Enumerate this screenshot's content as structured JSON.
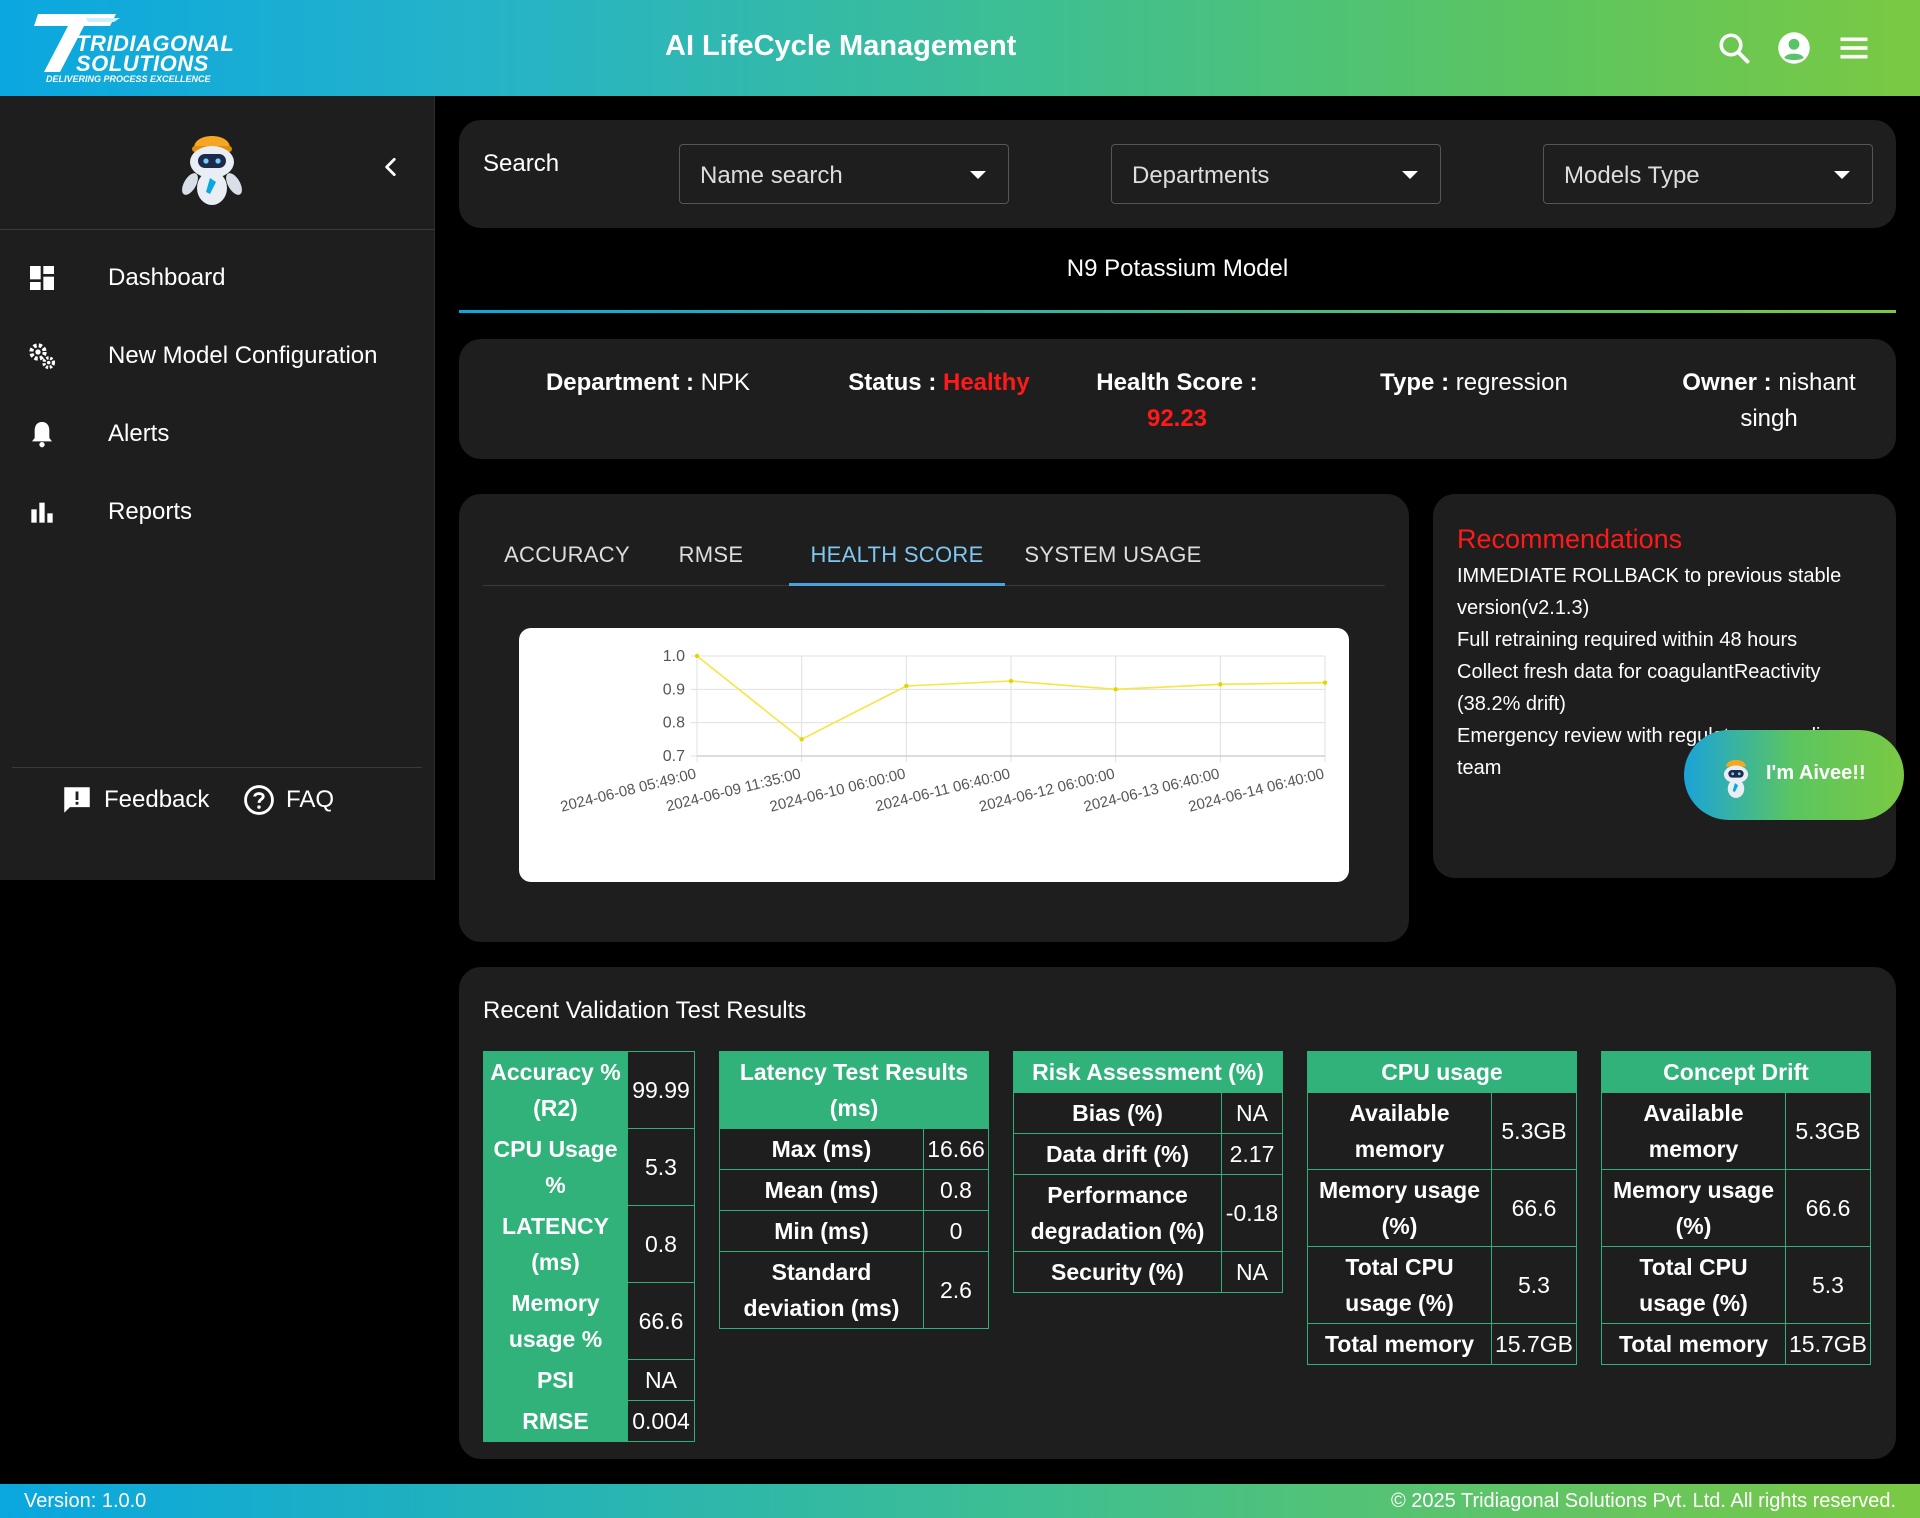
{
  "header": {
    "logo_line1": "TRIDIAGONAL",
    "logo_line2": "SOLUTIONS",
    "logo_tagline": "DELIVERING PROCESS EXCELLENCE",
    "title": "AI LifeCycle Management",
    "icons": [
      "search-icon",
      "account-icon",
      "menu-icon"
    ]
  },
  "sidebar": {
    "items": [
      {
        "label": "Dashboard",
        "icon": "dashboard-icon"
      },
      {
        "label": "New Model Configuration",
        "icon": "gears-icon"
      },
      {
        "label": "Alerts",
        "icon": "bell-icon"
      },
      {
        "label": "Reports",
        "icon": "bar-chart-icon"
      }
    ],
    "feedback_label": "Feedback",
    "faq_label": "FAQ"
  },
  "search": {
    "label": "Search",
    "name_search": "Name search",
    "departments": "Departments",
    "models_type": "Models Type"
  },
  "model": {
    "name": "N9 Potassium Model",
    "department_label": "Department :",
    "department": "NPK",
    "status_label": "Status :",
    "status": "Healthy",
    "health_score_label": "Health Score :",
    "health_score": "92.23",
    "type_label": "Type :",
    "type": "regression",
    "owner_label": "Owner :",
    "owner": "nishant singh"
  },
  "colors": {
    "accent_blue": "#0aa7e0",
    "accent_green": "#7ac943",
    "table_green": "#31b27a",
    "alert_red": "#ff1a1a",
    "line_yellow": "#f5e642"
  },
  "tabs": [
    {
      "label": "ACCURACY",
      "active": false
    },
    {
      "label": "RMSE",
      "active": false
    },
    {
      "label": "HEALTH SCORE",
      "active": true
    },
    {
      "label": "SYSTEM USAGE",
      "active": false
    }
  ],
  "chart_data": {
    "type": "line",
    "categories": [
      "2024-06-08 05:49:00",
      "2024-06-09 11:35:00",
      "2024-06-10 06:00:00",
      "2024-06-11 06:40:00",
      "2024-06-12 06:00:00",
      "2024-06-13 06:40:00",
      "2024-06-14 06:40:00"
    ],
    "values": [
      1.0,
      0.75,
      0.91,
      0.925,
      0.9,
      0.915,
      0.92
    ],
    "yticks": [
      "1.0",
      "0.9",
      "0.8",
      "0.7"
    ],
    "ylim": [
      0.7,
      1.0
    ],
    "grid": true
  },
  "recommendations": {
    "title": "Recommendations",
    "items": [
      "IMMEDIATE ROLLBACK to previous stable version(v2.1.3)",
      "Full retraining required within 48 hours",
      "Collect fresh data for coagulantReactivity (38.2% drift)",
      "Emergency review with regulatory compliance team"
    ]
  },
  "aivee": {
    "label": "I'm Aivee!!"
  },
  "validation": {
    "title": "Recent Validation Test Results",
    "summary": [
      {
        "k": "Accuracy % (R2)",
        "v": "99.99"
      },
      {
        "k": "CPU Usage %",
        "v": "5.3"
      },
      {
        "k": "LATENCY (ms)",
        "v": "0.8"
      },
      {
        "k": "Memory usage %",
        "v": "66.6"
      },
      {
        "k": "PSI",
        "v": "NA"
      },
      {
        "k": "RMSE",
        "v": "0.004"
      }
    ],
    "latency": {
      "title": "Latency Test Results (ms)",
      "rows": [
        {
          "k": "Max (ms)",
          "v": "16.66"
        },
        {
          "k": "Mean (ms)",
          "v": "0.8"
        },
        {
          "k": "Min (ms)",
          "v": "0"
        },
        {
          "k": "Standard deviation (ms)",
          "v": "2.6"
        }
      ]
    },
    "risk": {
      "title": "Risk Assessment (%)",
      "rows": [
        {
          "k": "Bias (%)",
          "v": "NA"
        },
        {
          "k": "Data drift (%)",
          "v": "2.17"
        },
        {
          "k": "Performance degradation (%)",
          "v": "-0.18"
        },
        {
          "k": "Security (%)",
          "v": "NA"
        }
      ]
    },
    "cpu": {
      "title": "CPU usage",
      "rows": [
        {
          "k": "Available memory",
          "v": "5.3GB"
        },
        {
          "k": "Memory usage (%)",
          "v": "66.6"
        },
        {
          "k": "Total CPU usage (%)",
          "v": "5.3"
        },
        {
          "k": "Total memory",
          "v": "15.7GB"
        }
      ]
    },
    "drift": {
      "title": "Concept Drift",
      "rows": [
        {
          "k": "Available memory",
          "v": "5.3GB"
        },
        {
          "k": "Memory usage (%)",
          "v": "66.6"
        },
        {
          "k": "Total CPU usage (%)",
          "v": "5.3"
        },
        {
          "k": "Total memory",
          "v": "15.7GB"
        }
      ]
    }
  },
  "footer": {
    "version": "Version: 1.0.0",
    "copyright": "© 2025 Tridiagonal Solutions Pvt. Ltd. All rights reserved."
  }
}
